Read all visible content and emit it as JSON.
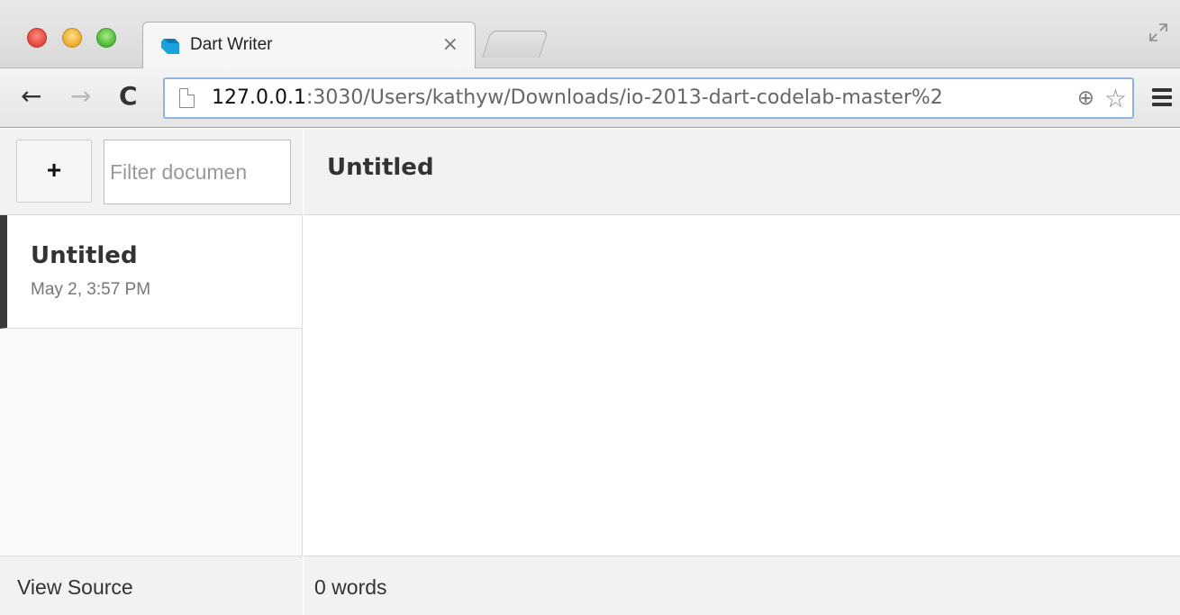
{
  "browser": {
    "tab": {
      "title": "Dart Writer",
      "close_glyph": "×"
    },
    "toolbar": {
      "back_glyph": "←",
      "forward_glyph": "→",
      "reload_glyph": "C",
      "url_host": "127.0.0.1",
      "url_rest": ":3030/Users/kathyw/Downloads/io-2013-dart-codelab-master%2",
      "zoom_glyph": "⊕",
      "star_glyph": "☆"
    },
    "colors": {
      "dart_logo": "#1aa2e0",
      "omnibox_focus": "#8fb4e3"
    }
  },
  "app": {
    "sidebar": {
      "add_label": "+",
      "filter_placeholder": "Filter documen",
      "documents": [
        {
          "title": "Untitled",
          "date": "May 2, 3:57 PM",
          "active": true
        }
      ],
      "footer_label": "View Source"
    },
    "main": {
      "title": "Untitled",
      "word_count": "0 words"
    }
  }
}
